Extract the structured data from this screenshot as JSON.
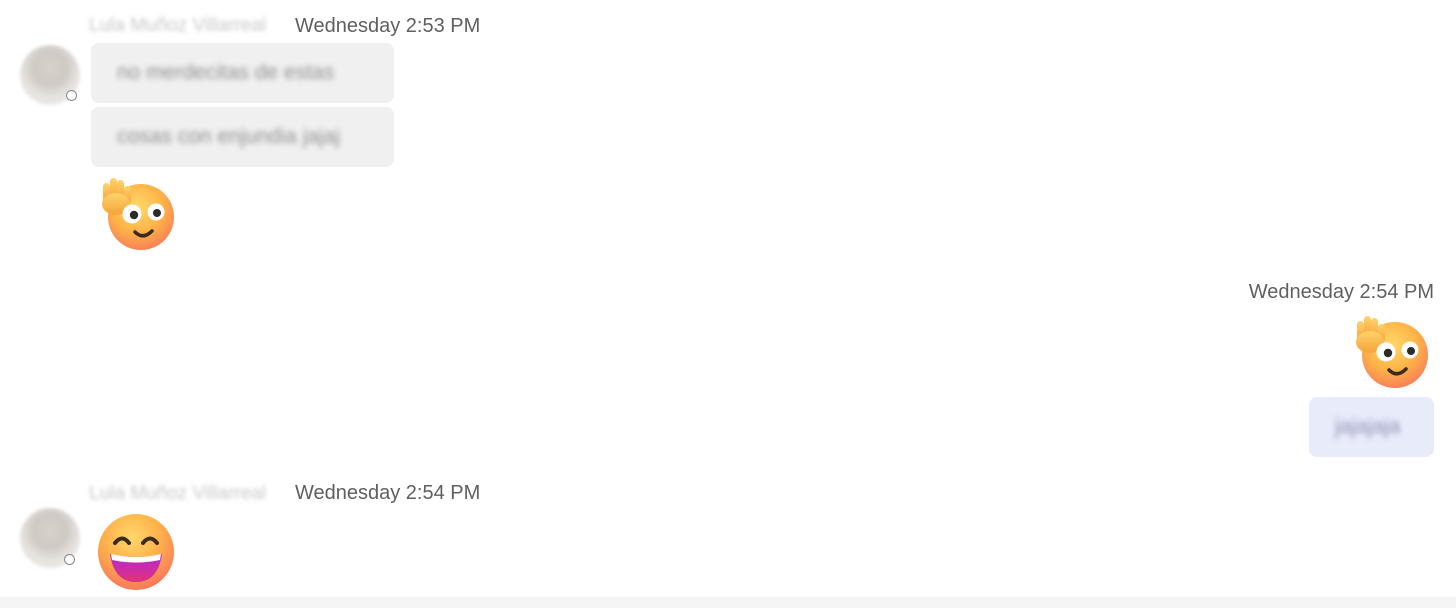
{
  "messages": [
    {
      "direction": "incoming",
      "sender": "Lula Muñoz Villarreal",
      "timestamp": "Wednesday 2:53 PM",
      "bubbles": [
        "no merdecitas de estas",
        "cosas con enjundia jajaj"
      ],
      "emoji": "waving-face-emoji"
    },
    {
      "direction": "outgoing",
      "timestamp": "Wednesday 2:54 PM",
      "emoji": "waving-face-emoji",
      "bubbles": [
        "jajajaja"
      ]
    },
    {
      "direction": "incoming",
      "sender": "Lula Muñoz Villarreal",
      "timestamp": "Wednesday 2:54 PM",
      "emoji": "grinning-face-emoji"
    }
  ],
  "colors": {
    "incoming_bubble": "#f0f0f0",
    "outgoing_bubble": "#e8ebfa",
    "timestamp_text": "#5f5f5f"
  }
}
